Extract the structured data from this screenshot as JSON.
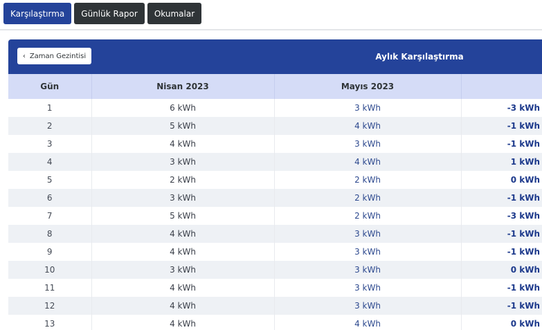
{
  "tabs": [
    {
      "label": "Karşılaştırma",
      "active": true
    },
    {
      "label": "Günlük Rapor",
      "active": false
    },
    {
      "label": "Okumalar",
      "active": false
    }
  ],
  "panel": {
    "back_label": "Zaman Gezintisi",
    "title": "Aylık Karşılaştırma"
  },
  "table": {
    "headers": [
      "Gün",
      "Nisan 2023",
      "Mayıs 2023",
      ""
    ],
    "rows": [
      {
        "day": "1",
        "a": "6 kWh",
        "b": "3 kWh",
        "diff": "-3 kWh"
      },
      {
        "day": "2",
        "a": "5 kWh",
        "b": "4 kWh",
        "diff": "-1 kWh"
      },
      {
        "day": "3",
        "a": "4 kWh",
        "b": "3 kWh",
        "diff": "-1 kWh"
      },
      {
        "day": "4",
        "a": "3 kWh",
        "b": "4 kWh",
        "diff": "1 kWh"
      },
      {
        "day": "5",
        "a": "2 kWh",
        "b": "2 kWh",
        "diff": "0 kWh"
      },
      {
        "day": "6",
        "a": "3 kWh",
        "b": "2 kWh",
        "diff": "-1 kWh"
      },
      {
        "day": "7",
        "a": "5 kWh",
        "b": "2 kWh",
        "diff": "-3 kWh"
      },
      {
        "day": "8",
        "a": "4 kWh",
        "b": "3 kWh",
        "diff": "-1 kWh"
      },
      {
        "day": "9",
        "a": "4 kWh",
        "b": "3 kWh",
        "diff": "-1 kWh"
      },
      {
        "day": "10",
        "a": "3 kWh",
        "b": "3 kWh",
        "diff": "0 kWh"
      },
      {
        "day": "11",
        "a": "4 kWh",
        "b": "3 kWh",
        "diff": "-1 kWh"
      },
      {
        "day": "12",
        "a": "4 kWh",
        "b": "3 kWh",
        "diff": "-1 kWh"
      },
      {
        "day": "13",
        "a": "4 kWh",
        "b": "4 kWh",
        "diff": "0 kWh"
      }
    ]
  },
  "colors": {
    "accent": "#24439a",
    "tab_dark": "#2f3437",
    "header_row": "#d5dcf7",
    "stripe": "#eef1f5"
  }
}
